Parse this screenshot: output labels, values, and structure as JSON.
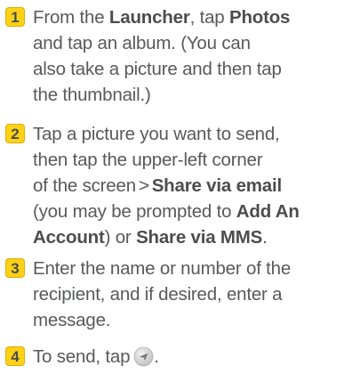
{
  "steps": [
    {
      "number": "1",
      "lines": [
        {
          "a": "From the ",
          "b": "Launcher",
          "c": ", tap ",
          "d": "Photos"
        },
        {
          "a": "and tap an album. (You can"
        },
        {
          "a": "also take a picture and then tap"
        },
        {
          "a": "the thumbnail.)"
        }
      ]
    },
    {
      "number": "2",
      "lines": [
        {
          "a": "Tap a picture you want to send,"
        },
        {
          "a": "then tap the upper-left corner"
        },
        {
          "a": "of the screen",
          "chevron": ">",
          "b": "Share via email"
        },
        {
          "a": "(you may be prompted to ",
          "b": "Add An"
        },
        {
          "b": "Account",
          "c": ") or ",
          "d": "Share via MMS",
          "e": "."
        }
      ]
    },
    {
      "number": "3",
      "lines": [
        {
          "a": "Enter the name or number of the"
        },
        {
          "a": "recipient, and if desired, enter a"
        },
        {
          "a": "message."
        }
      ]
    },
    {
      "number": "4",
      "lines": [
        {
          "a": "To send, tap",
          "icon": "send-icon",
          "e": "."
        }
      ]
    }
  ],
  "colors": {
    "badge": "#fcd116",
    "text": "#58595b"
  }
}
